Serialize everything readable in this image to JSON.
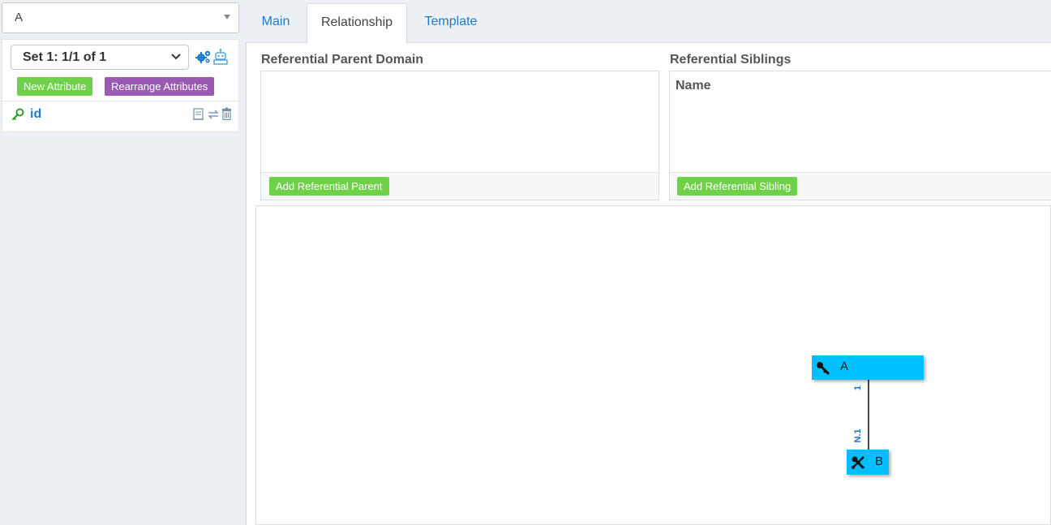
{
  "entity_select": {
    "value": "A"
  },
  "attributes": {
    "set_select": "Set 1: 1/1 of 1",
    "new_attribute_label": "New Attribute",
    "rearrange_label": "Rearrange Attributes",
    "items": [
      {
        "name": "id"
      }
    ]
  },
  "tabs": [
    {
      "label": "Main"
    },
    {
      "label": "Relationship",
      "active": true
    },
    {
      "label": "Template"
    }
  ],
  "referential_parent": {
    "title": "Referential Parent Domain",
    "add_label": "Add Referential Parent"
  },
  "referential_siblings": {
    "title": "Referential Siblings",
    "column_header": "Name",
    "add_label": "Add Referential Sibling"
  },
  "diagram": {
    "nodes": [
      {
        "label": "A",
        "icon": "key-icon"
      },
      {
        "label": "B",
        "icon": "key-tool-icon"
      }
    ],
    "edge": {
      "parent_cardinality": "1",
      "child_cardinality": "N.1"
    }
  },
  "colors": {
    "green_button": "#6fd147",
    "purple_button": "#9b59b6",
    "link_blue": "#1a7bd0",
    "node_fill": "#00bfff"
  }
}
